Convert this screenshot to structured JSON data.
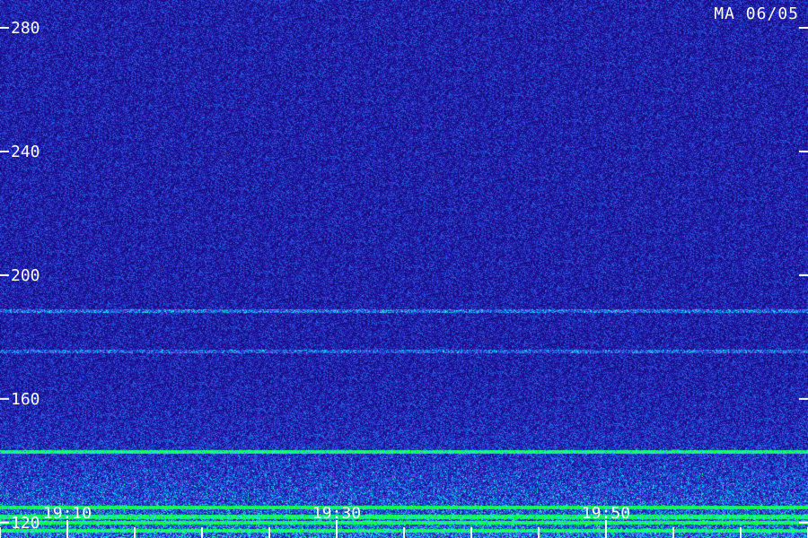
{
  "station_label": "MA 06/05",
  "colors": {
    "background": "#1a0f8c",
    "noise_low": "#0b0760",
    "noise_mid": "#3a2fd8",
    "signal_cyan": "#22c6ff",
    "signal_green": "#2cff8a",
    "axis": "#ffffff"
  },
  "chart_data": {
    "type": "heatmap",
    "title": "",
    "xlabel": "",
    "ylabel": "",
    "y_ticks": [
      {
        "value": 280,
        "label": "280"
      },
      {
        "value": 240,
        "label": "240"
      },
      {
        "value": 200,
        "label": "200"
      },
      {
        "value": 160,
        "label": "160"
      },
      {
        "value": 120,
        "label": "120"
      }
    ],
    "y_range": [
      115,
      289
    ],
    "x_ticks": [
      {
        "minute": 10,
        "label": "19:10"
      },
      {
        "minute": 30,
        "label": "19:30"
      },
      {
        "minute": 50,
        "label": "19:50"
      }
    ],
    "x_range_minutes": [
      5,
      65
    ],
    "x_minor_tick_interval_minutes": 5,
    "signal_bands": [
      {
        "value": 143.0,
        "intensity": 0.85,
        "color": "green"
      },
      {
        "value": 125.0,
        "intensity": 0.95,
        "color": "green"
      },
      {
        "value": 122.0,
        "intensity": 0.75,
        "color": "green"
      },
      {
        "value": 120.0,
        "intensity": 0.8,
        "color": "green"
      },
      {
        "value": 117.5,
        "intensity": 0.7,
        "color": "green"
      },
      {
        "value": 188.5,
        "intensity": 0.35,
        "color": "cyan"
      },
      {
        "value": 175.5,
        "intensity": 0.3,
        "color": "cyan"
      }
    ]
  }
}
